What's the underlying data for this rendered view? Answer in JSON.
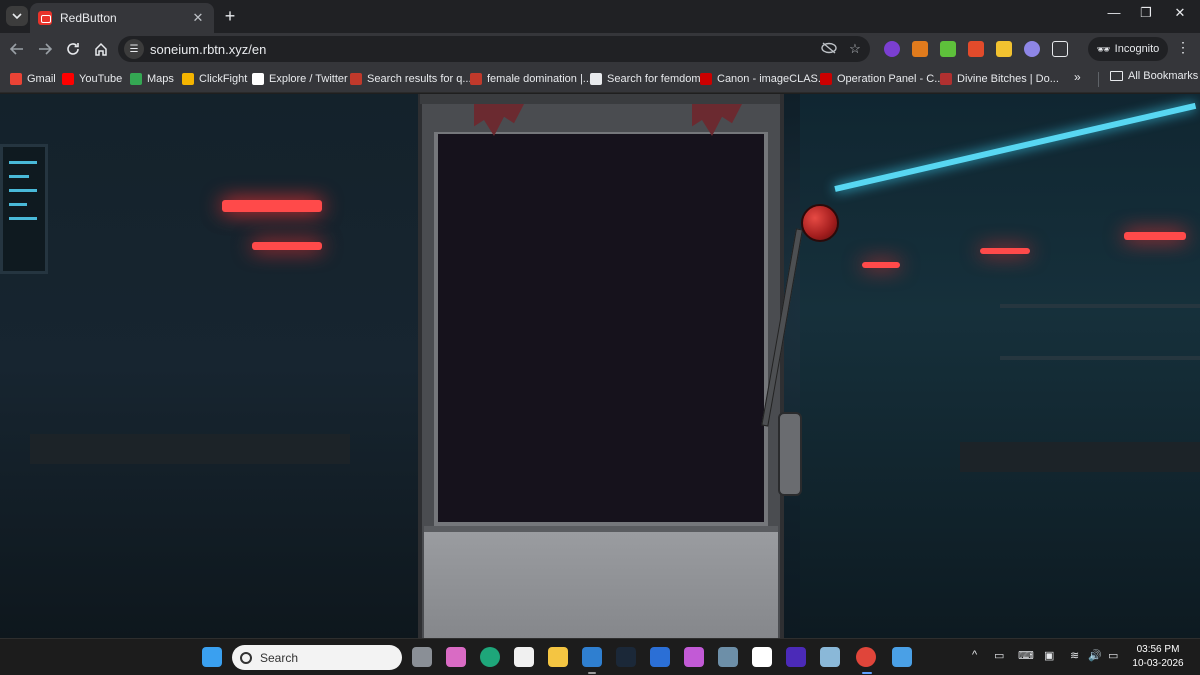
{
  "browser": {
    "tab": {
      "title": "RedButton",
      "close": "✕"
    },
    "new_tab": "+",
    "window_controls": {
      "minimize": "—",
      "restore": "❐",
      "close": "✕"
    },
    "address": "soneium.rbtn.xyz/en",
    "incognito_label": "Incognito",
    "menu": "⋮"
  },
  "bookmarks": {
    "items": [
      {
        "label": "Gmail",
        "icon": "gmail-icon",
        "color": "#ea4335"
      },
      {
        "label": "YouTube",
        "icon": "youtube-icon",
        "color": "#ff0000"
      },
      {
        "label": "Maps",
        "icon": "maps-icon",
        "color": "#34a853"
      },
      {
        "label": "ClickFight",
        "icon": "clickfight-icon",
        "color": "#f4b400"
      },
      {
        "label": "Explore / Twitter",
        "icon": "x-icon",
        "color": "#ffffff"
      },
      {
        "label": "Search results for q...",
        "icon": "f95-icon",
        "color": "#c0392b"
      },
      {
        "label": "female domination |...",
        "icon": "f95-icon",
        "color": "#c0392b"
      },
      {
        "label": "Search for femdom",
        "icon": "figure-icon",
        "color": "#e8eaed"
      },
      {
        "label": "Canon - imageCLAS...",
        "icon": "canon-icon",
        "color": "#cc0000"
      },
      {
        "label": "Operation Panel - C...",
        "icon": "canon-icon",
        "color": "#cc0000"
      },
      {
        "label": "Divine Bitches | Do...",
        "icon": "divine-icon",
        "color": "#b03030"
      }
    ],
    "more": "»",
    "all_bookmarks": "All Bookmarks"
  },
  "taskbar": {
    "search_placeholder": "Search",
    "clock_time": "03:56 PM",
    "clock_date": "10-03-2026",
    "tray_chevron": "^"
  },
  "colors": {
    "accent_red": "#e8332a",
    "neon_cyan": "#58d7f2"
  }
}
